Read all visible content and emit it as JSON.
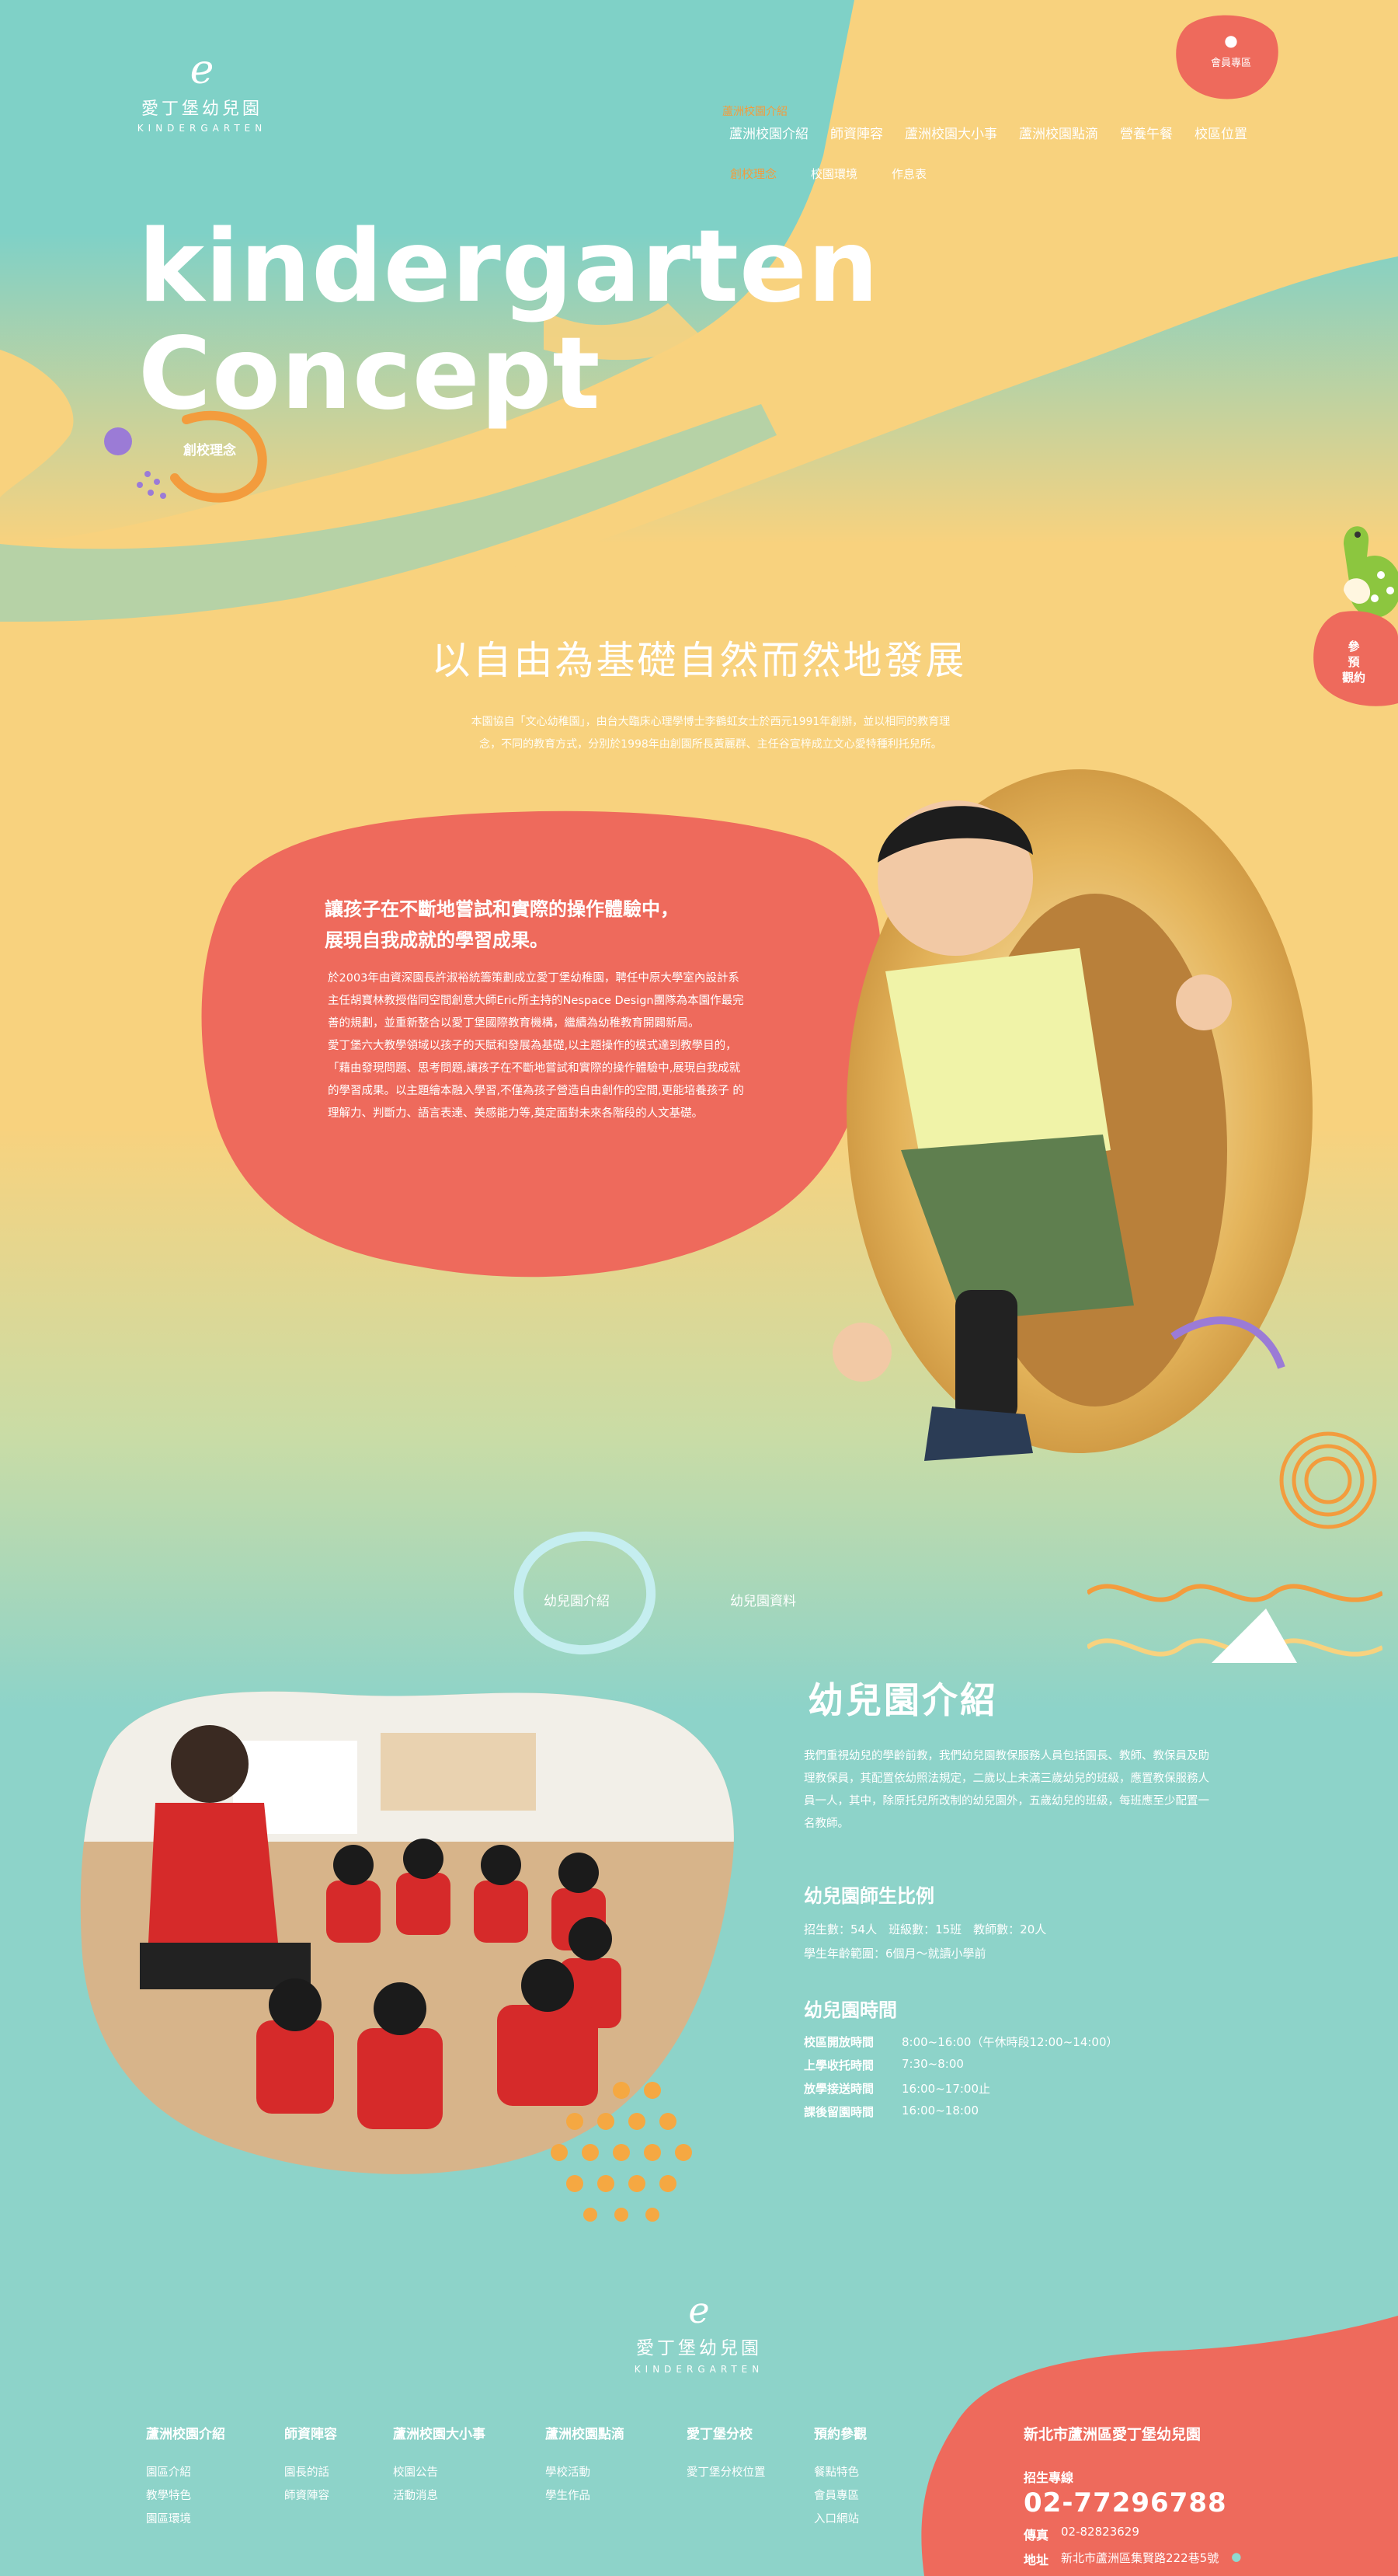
{
  "header": {
    "logo_mark": "e",
    "logo_name": "愛丁堡幼兒園",
    "logo_sub": "KINDERGARTEN",
    "member_label": "會員專區",
    "member_icon": "user-icon",
    "nav_top_label": "蘆洲校園介紹",
    "nav": [
      "蘆洲校園介紹",
      "師資陣容",
      "蘆洲校園大小事",
      "蘆洲校園點滴",
      "營養午餐",
      "校區位置"
    ],
    "subnav": [
      "創校理念",
      "校園環境",
      "作息表"
    ]
  },
  "hero": {
    "title_line1": "kindergarten",
    "title_line2": "Concept",
    "subtitle": "創校理念"
  },
  "side_button": {
    "line1": "參",
    "line2": "預",
    "line3": "觀約"
  },
  "concept": {
    "heading": "以自由為基礎自然而然地發展",
    "intro": "本園協自「文心幼稚園」，由台大臨床心理學博士李鶴虹女士於西元1991年創辦，並以相同的教育理念，不同的教育方式，分別於1998年由創園所長黃麗群、主任谷宣梓成立文心愛特種利托兒所。",
    "blob_title_1": "讓孩子在不斷地嘗試和實際的操作體驗中，",
    "blob_title_2": "展現自我成就的學習成果。",
    "blob_paragraphs": [
      "於2003年由資深園長許淑裕統籌策劃成立愛丁堡幼稚園，聘任中原大學室內設計系主任胡寶林教授偕同空間創意大師Eric所主持的Nespace Design團隊為本園作最完善的規劃，並重新整合以愛丁堡國際教育機構，繼續為幼稚教育開闢新局。",
      "愛丁堡六大教學領域以孩子的天賦和發展為基礎,以主題操作的模式達到教學目的，「藉由發現問題、思考問題,讓孩子在不斷地嘗試和實際的操作體驗中,展現自我成就 的學習成果。以主題繪本融入學習,不僅為孩子營造自由創作的空間,更能培養孩子 的理解力、判斷力、語言表達、美感能力等,奠定面對未來各階段的人文基礎。"
    ]
  },
  "tabs": [
    "幼兒園介紹",
    "幼兒園資料"
  ],
  "info": {
    "title": "幼兒園介紹",
    "intro": "我們重視幼兒的學齡前教，我們幼兒園教保服務人員包括園長、教師、教保員及助理教保員，其配置依幼照法規定，二歲以上未滿三歲幼兒的班級，應置教保服務人員一人，其中，除原托兒所改制的幼兒園外，五歲幼兒的班級，每班應至少配置一名教師。",
    "ratio_title": "幼兒園師生比例",
    "ratio_line1": "招生數：54人　班級數：15班　教師數：20人",
    "ratio_line2": "學生年齡範圍：6個月～就讀小學前",
    "hours_title": "幼兒園時間",
    "hours": [
      {
        "k": "校區開放時間",
        "v": "8:00~16:00（午休時段12:00~14:00）"
      },
      {
        "k": "上學收托時間",
        "v": "7:30~8:00"
      },
      {
        "k": "放學接送時間",
        "v": "16:00~17:00止"
      },
      {
        "k": "課後留園時間",
        "v": "16:00~18:00"
      }
    ]
  },
  "footer": {
    "logo_mark": "e",
    "logo_name": "愛丁堡幼兒園",
    "logo_sub": "KINDERGARTEN",
    "columns": [
      {
        "h": "蘆洲校園介紹",
        "links": [
          "園區介紹",
          "教學特色",
          "園區環境"
        ]
      },
      {
        "h": "師資陣容",
        "links": [
          "園長的話",
          "師資陣容"
        ]
      },
      {
        "h": "蘆洲校園大小事",
        "links": [
          "校園公告",
          "活動消息"
        ]
      },
      {
        "h": "蘆洲校園點滴",
        "links": [
          "學校活動",
          "學生作品"
        ]
      },
      {
        "h": "愛丁堡分校",
        "links": [
          "愛丁堡分校位置"
        ]
      },
      {
        "h": "預約參觀",
        "links": [
          "餐點特色",
          "會員專區",
          "入口網站"
        ]
      }
    ],
    "contact": {
      "school": "新北市蘆洲區愛丁堡幼兒園",
      "phone_label": "招生專線",
      "phone": "02-77296788",
      "fax_label": "傳真",
      "fax": "02-82823629",
      "addr_label": "地址",
      "addr": "新北市蘆洲區集賢路222巷5號",
      "pin_icon": "map-pin-icon"
    }
  },
  "colors": {
    "teal": "#7fd1c7",
    "yellow": "#f8d27e",
    "coral": "#ee6a5c",
    "orange": "#f39c3d"
  }
}
